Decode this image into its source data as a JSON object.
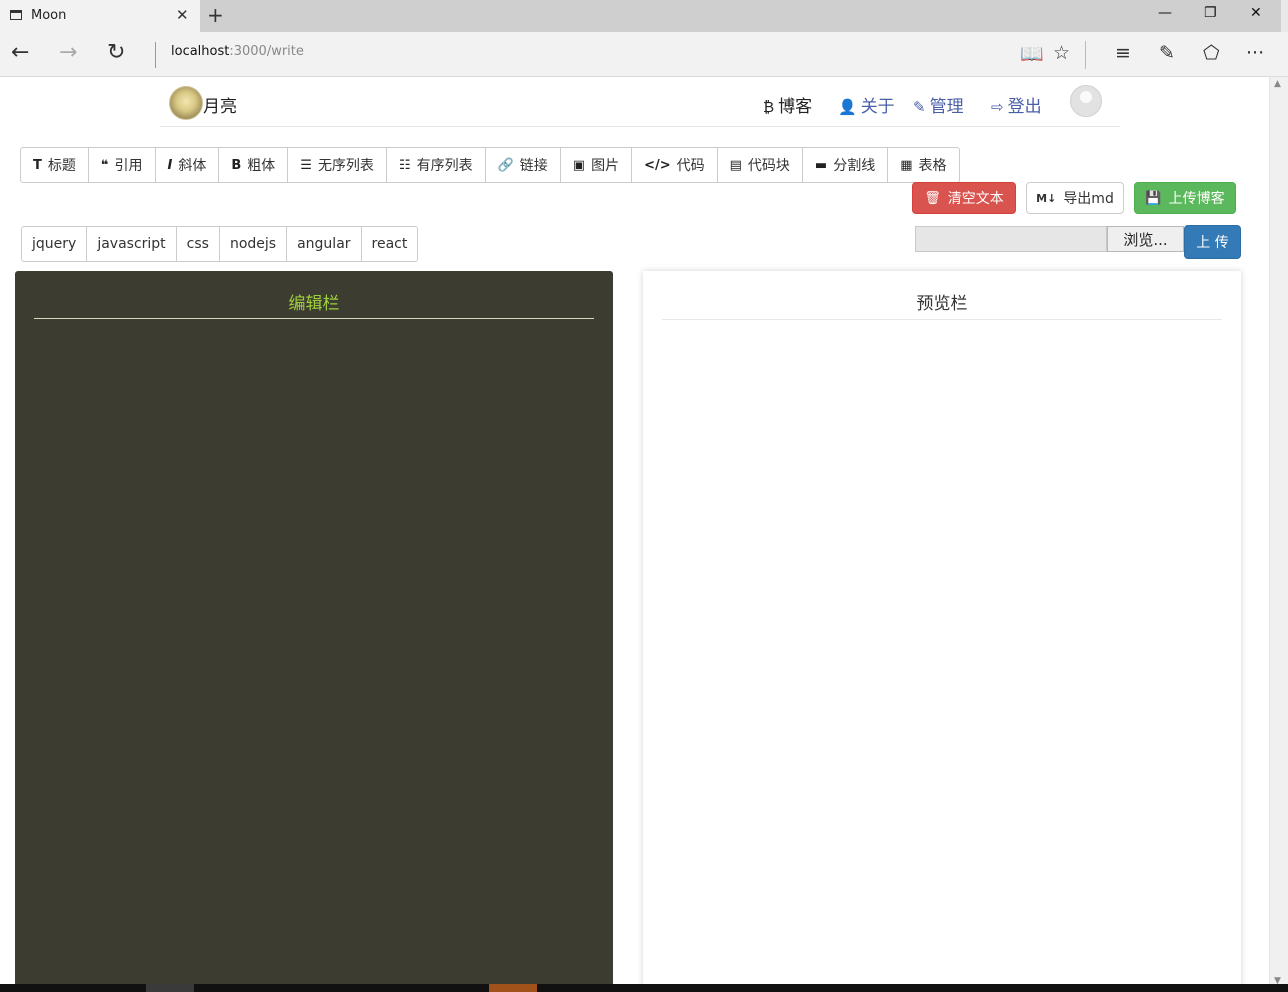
{
  "browser": {
    "tab_title": "Moon",
    "tab_close": "✕",
    "new_tab": "+",
    "url_host": "localhost",
    "url_path": ":3000/write",
    "back": "←",
    "forward": "→",
    "refresh": "↻",
    "minimize": "—",
    "restore": "❐",
    "close": "✕",
    "reading_view": "📖",
    "favorite": "☆",
    "hub": "≡",
    "web_note": "✎",
    "share": "⬠",
    "more": "···"
  },
  "header": {
    "site_name": "月亮",
    "nav": [
      {
        "icon": "₿",
        "label": "博客"
      },
      {
        "icon": "👤",
        "label": "关于"
      },
      {
        "icon": "✎",
        "label": "管理"
      },
      {
        "icon": "⇨",
        "label": "登出"
      }
    ]
  },
  "toolbar": {
    "items": [
      {
        "icon": "T",
        "label": "标题"
      },
      {
        "icon": "❝",
        "label": "引用"
      },
      {
        "icon": "I",
        "label": "斜体"
      },
      {
        "icon": "B",
        "label": "粗体"
      },
      {
        "icon": "☰",
        "label": "无序列表"
      },
      {
        "icon": "☷",
        "label": "有序列表"
      },
      {
        "icon": "🔗",
        "label": "链接"
      },
      {
        "icon": "▣",
        "label": "图片"
      },
      {
        "icon": "</>",
        "label": "代码"
      },
      {
        "icon": "▤",
        "label": "代码块"
      },
      {
        "icon": "▬",
        "label": "分割线"
      },
      {
        "icon": "▦",
        "label": "表格"
      }
    ]
  },
  "actions": {
    "clear": {
      "icon": "🗑",
      "label": "清空文本"
    },
    "export": {
      "icon": "M↓",
      "label": "导出md"
    },
    "publish": {
      "icon": "💾",
      "label": "上传博客"
    }
  },
  "tags": [
    "jquery",
    "javascript",
    "css",
    "nodejs",
    "angular",
    "react"
  ],
  "upload": {
    "browse_label": "浏览...",
    "upload_label": "上 传"
  },
  "editor": {
    "title": "编辑栏",
    "content": ""
  },
  "preview": {
    "title": "预览栏"
  },
  "colors": {
    "editor_bg": "#3c3c30",
    "editor_title": "#9ed03b",
    "danger": "#d9534f",
    "success": "#5cb85c",
    "primary": "#337ab7",
    "nav_link": "#4a5fa8"
  }
}
